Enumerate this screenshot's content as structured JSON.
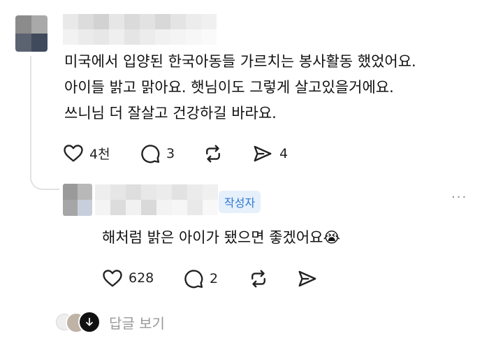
{
  "comment": {
    "lines": [
      "미국에서 입양된 한국아동들 가르치는 봉사활동 했었어요.",
      "아이들 밝고 맑아요. 햇님이도 그렇게 살고있을거에요.",
      "쓰니님 더 잘살고 건강하길 바라요."
    ],
    "likes": "4천",
    "comments": "3",
    "shares": "4"
  },
  "reply": {
    "author_badge": "작성자",
    "text": "해처럼 밝은 아이가 됐으면 좋겠어요",
    "emoji": "😭",
    "likes": "628",
    "comments": "2",
    "more": "···"
  },
  "view_replies_label": "답글 보기",
  "colors": {
    "badge_bg": "#e6f0fb",
    "badge_text": "#2f78d3",
    "icon": "#222222",
    "muted": "#999999"
  },
  "icons": [
    "heart-icon",
    "comment-bubble-icon",
    "repost-icon",
    "send-icon",
    "more-icon",
    "arrow-down-icon"
  ]
}
